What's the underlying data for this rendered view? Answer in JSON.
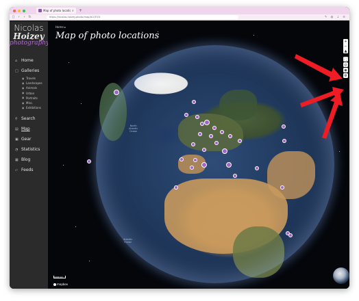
{
  "browser": {
    "tab_title": "Map of photo locations – Nico",
    "tab_close": "×",
    "new_tab": "+",
    "url": "https://nicolas.hoizey.photo/map/#2/35/3",
    "traffic_colors": [
      "#fe5f57",
      "#febc2e",
      "#28c840"
    ]
  },
  "brand": {
    "line1": "Nicolas",
    "line2": "Hoizey",
    "line3": "photography"
  },
  "sidebar": {
    "items": [
      {
        "label": "Home",
        "icon": "home-icon",
        "glyph": "⌂"
      },
      {
        "label": "Galleries",
        "icon": "folder-icon",
        "glyph": "□"
      }
    ],
    "galleries": [
      {
        "label": "Travels"
      },
      {
        "label": "Landscapes"
      },
      {
        "label": "Animals"
      },
      {
        "label": "Urban"
      },
      {
        "label": "Portraits"
      },
      {
        "label": "Misc."
      },
      {
        "label": "Exhibitions"
      }
    ],
    "items2": [
      {
        "label": "Search",
        "icon": "search-icon",
        "glyph": "⚲"
      },
      {
        "label": "Map",
        "icon": "map-icon",
        "glyph": "▤"
      },
      {
        "label": "Gear",
        "icon": "camera-icon",
        "glyph": "▣"
      },
      {
        "label": "Statistics",
        "icon": "stats-icon",
        "glyph": "◔"
      },
      {
        "label": "Blog",
        "icon": "blog-icon",
        "glyph": "▦"
      },
      {
        "label": "Feeds",
        "icon": "rss-icon",
        "glyph": "▱"
      }
    ]
  },
  "main": {
    "breadcrumb": "Home ▸",
    "title": "Map of photo locations",
    "ocean_label_1": "North\nAtlantic\nOcean",
    "ocean_label_2": "Atlantic\nOcean",
    "marker_color": "#a364c9"
  },
  "controls": {
    "zoom_in": "+",
    "zoom_out": "−",
    "compass": "▲",
    "fullscreen": "⛶",
    "locate": "◎",
    "layers": "◉",
    "settings": "⚙"
  },
  "map_footer": {
    "scale": "1000 km",
    "attribution": "mapbox"
  },
  "accent": "#b36bd4",
  "arrow_color": "#ee1c25"
}
